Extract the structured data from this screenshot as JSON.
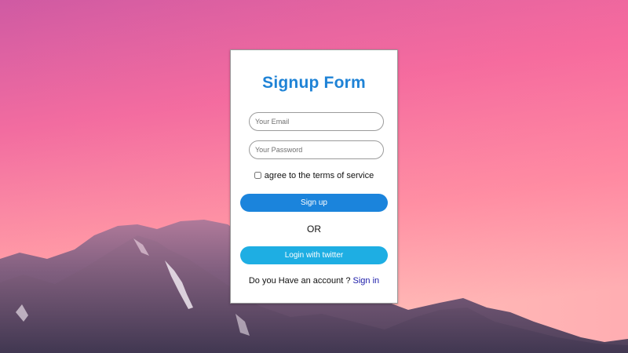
{
  "form": {
    "title": "Signup Form",
    "email_placeholder": "Your Email",
    "password_placeholder": "Your Password",
    "terms_label": "agree to the terms of service",
    "signup_label": "Sign up",
    "or_label": "OR",
    "twitter_label": "Login with twitter",
    "account_prompt": "Do you Have an account ?",
    "signin_link": "Sign in"
  },
  "colors": {
    "title": "#1f83d6",
    "signup_button": "#1b84dc",
    "twitter_button": "#1eaee3",
    "link": "#1a1aa8",
    "sky_top": "#d95aa0",
    "sky_bottom": "#ffb6b0"
  }
}
